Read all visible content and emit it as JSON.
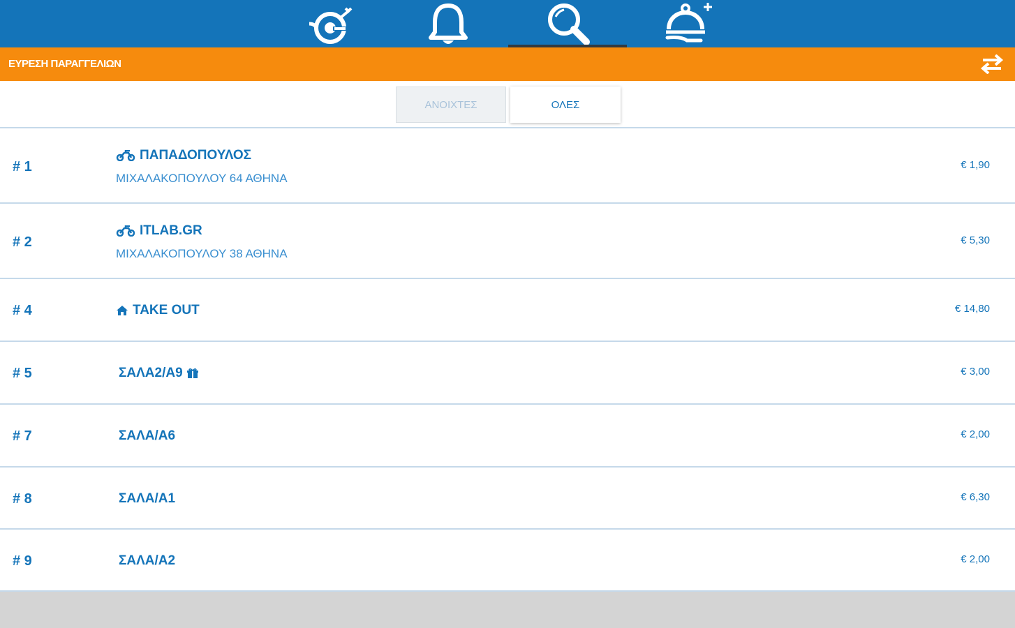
{
  "nav": {
    "items": [
      {
        "name": "delivery-icon",
        "active": false
      },
      {
        "name": "bell-icon",
        "active": false
      },
      {
        "name": "search-icon",
        "active": true
      },
      {
        "name": "serving-cloche-icon",
        "active": false
      }
    ]
  },
  "header": {
    "title": "ΕΥΡΕΣΗ ΠΑΡΑΓΓΕΛΙΩΝ",
    "filter_icon": "swap-arrows-icon"
  },
  "tabs": {
    "open_label": "ΑΝΟΙΧΤΕΣ",
    "all_label": "ΟΛΕΣ",
    "selected": "all"
  },
  "orders": [
    {
      "number": "# 1",
      "icon": "scooter-icon",
      "title": "ΠΑΠΑΔΟΠΟΥΛΟΣ",
      "address": "ΜΙΧΑΛΑΚΟΠΟΥΛΟΥ 64  ΑΘΗΝΑ",
      "price": "€ 1,90"
    },
    {
      "number": "# 2",
      "icon": "scooter-icon",
      "title": "ITLAB.GR",
      "address": "ΜΙΧΑΛΑΚΟΠΟΥΛΟΥ 38  ΑΘΗΝΑ",
      "price": "€ 5,30"
    },
    {
      "number": "# 4",
      "icon": "home-icon",
      "title": "TAKE OUT",
      "price": "€ 14,80"
    },
    {
      "number": "# 5",
      "title": "ΣΑΛΑ2/Α9",
      "trailing_icon": "gift-icon",
      "price": "€ 3,00"
    },
    {
      "number": "# 7",
      "title": "ΣΑΛΑ/Α6",
      "price": "€ 2,00"
    },
    {
      "number": "# 8",
      "title": "ΣΑΛΑ/Α1",
      "price": "€ 6,30"
    },
    {
      "number": "# 9",
      "title": "ΣΑΛΑ/Α2",
      "price": "€ 2,00"
    }
  ],
  "colors": {
    "nav_bg": "#1474b9",
    "header_bg": "#f68b0d",
    "text_primary": "#1474b9",
    "divider": "#c5d9ea"
  }
}
